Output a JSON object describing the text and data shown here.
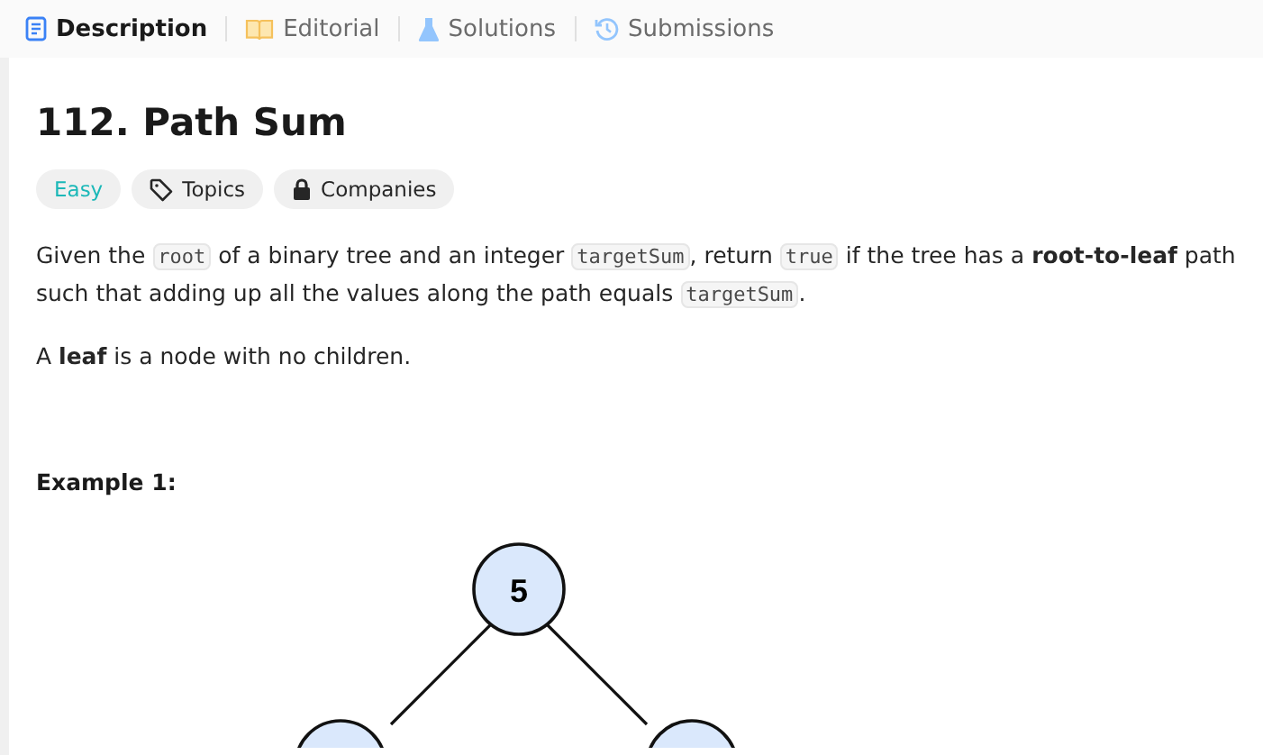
{
  "tabs": [
    {
      "label": "Description",
      "kind": "document",
      "selected": true
    },
    {
      "label": "Editorial",
      "kind": "book",
      "selected": false
    },
    {
      "label": "Solutions",
      "kind": "flask",
      "selected": false
    },
    {
      "label": "Submissions",
      "kind": "history",
      "selected": false
    }
  ],
  "title": "112. Path Sum",
  "tags": [
    {
      "label": "Easy",
      "kind": "difficulty"
    },
    {
      "label": "Topics",
      "kind": "tag"
    },
    {
      "label": "Companies",
      "kind": "lock"
    }
  ],
  "paragraphs": [
    [
      {
        "kind": "text",
        "text": "Given the "
      },
      {
        "kind": "code",
        "text": "root"
      },
      {
        "kind": "text",
        "text": " of a binary tree and an integer "
      },
      {
        "kind": "code",
        "text": "targetSum"
      },
      {
        "kind": "text",
        "text": ", return "
      },
      {
        "kind": "code",
        "text": "true"
      },
      {
        "kind": "text",
        "text": " if the tree has a "
      },
      {
        "kind": "bold",
        "text": "root-to-leaf"
      },
      {
        "kind": "text",
        "text": " path such that adding up all the values along the path equals "
      },
      {
        "kind": "code",
        "text": "targetSum"
      },
      {
        "kind": "text",
        "text": "."
      }
    ],
    [
      {
        "kind": "text",
        "text": "A "
      },
      {
        "kind": "bold",
        "text": "leaf"
      },
      {
        "kind": "text",
        "text": " is a node with no children."
      }
    ]
  ],
  "example_heading": "Example 1:",
  "tree": {
    "root": "5"
  }
}
